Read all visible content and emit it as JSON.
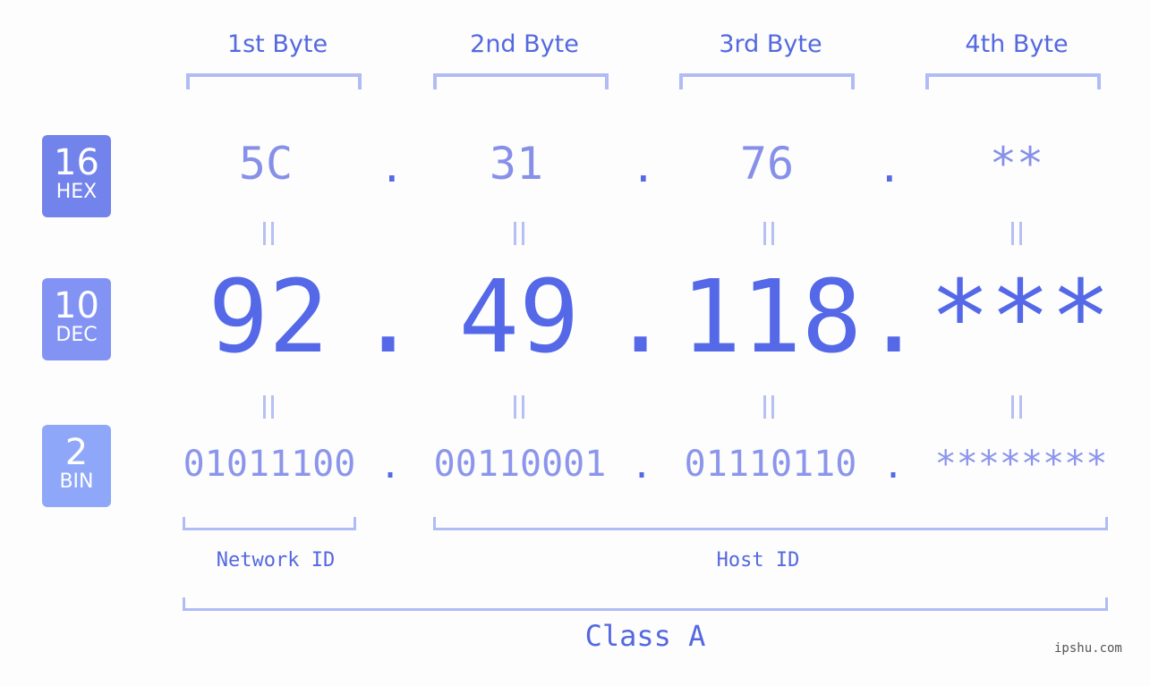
{
  "byte_headers": [
    "1st Byte",
    "2nd Byte",
    "3rd Byte",
    "4th Byte"
  ],
  "badges": [
    {
      "number": "16",
      "label": "HEX",
      "color": "#7383ec"
    },
    {
      "number": "10",
      "label": "DEC",
      "color": "#8393f4"
    },
    {
      "number": "2",
      "label": "BIN",
      "color": "#8fa7f9"
    }
  ],
  "hex": [
    "5C",
    "31",
    "76",
    "**"
  ],
  "dec": [
    "92",
    "49",
    "118",
    "***"
  ],
  "bin": [
    "01011100",
    "00110001",
    "01110110",
    "********"
  ],
  "separator": ".",
  "network_id_label": "Network ID",
  "host_id_label": "Host ID",
  "class_label": "Class A",
  "watermark": "ipshu.com",
  "colors": {
    "accent": "#5468e8",
    "bracket": "#b2bcf4",
    "light_text": "#8790e8"
  }
}
